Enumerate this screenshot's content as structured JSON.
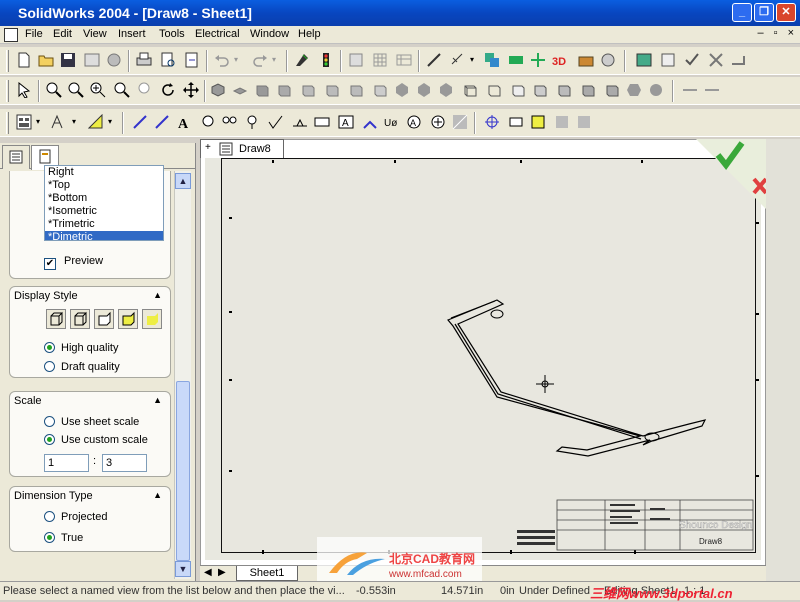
{
  "window": {
    "title": "SolidWorks 2004 - [Draw8 - Sheet1]"
  },
  "menu": [
    "File",
    "Edit",
    "View",
    "Insert",
    "Tools",
    "Electrical",
    "Window",
    "Help"
  ],
  "panel": {
    "views": [
      "Right",
      "*Top",
      "*Bottom",
      "*Isometric",
      "*Trimetric",
      "*Dimetric"
    ],
    "selected_view_index": 5,
    "preview_label": "Preview",
    "preview_checked": true,
    "display_style": {
      "header": "Display Style",
      "options": [
        "High quality",
        "Draft quality"
      ],
      "selected": "High quality"
    },
    "scale": {
      "header": "Scale",
      "options": [
        "Use sheet scale",
        "Use custom scale"
      ],
      "selected": "Use custom scale",
      "numerator": "1",
      "separator": ":",
      "denominator": "3"
    },
    "dimension_type": {
      "header": "Dimension Type",
      "options": [
        "Projected",
        "True"
      ],
      "selected": "True"
    }
  },
  "drawing": {
    "doc_tab": "Draw8",
    "sheet_tab": "Sheet1",
    "title_block_text": "Shounco Design",
    "title_block_name": "Draw8"
  },
  "statusbar": {
    "message": "Please select a named view from the list below and then place the vi...",
    "x": "-0.553in",
    "y": "14.571in",
    "z": "0in",
    "state": "Under Defined",
    "mode": "Editing Sheet1",
    "scale": "1 : 1"
  },
  "watermarks": {
    "logo_text": "北京CAD教育网",
    "logo_url": "www.mfcad.com",
    "portal": "三维网www.3dportal.cn"
  }
}
